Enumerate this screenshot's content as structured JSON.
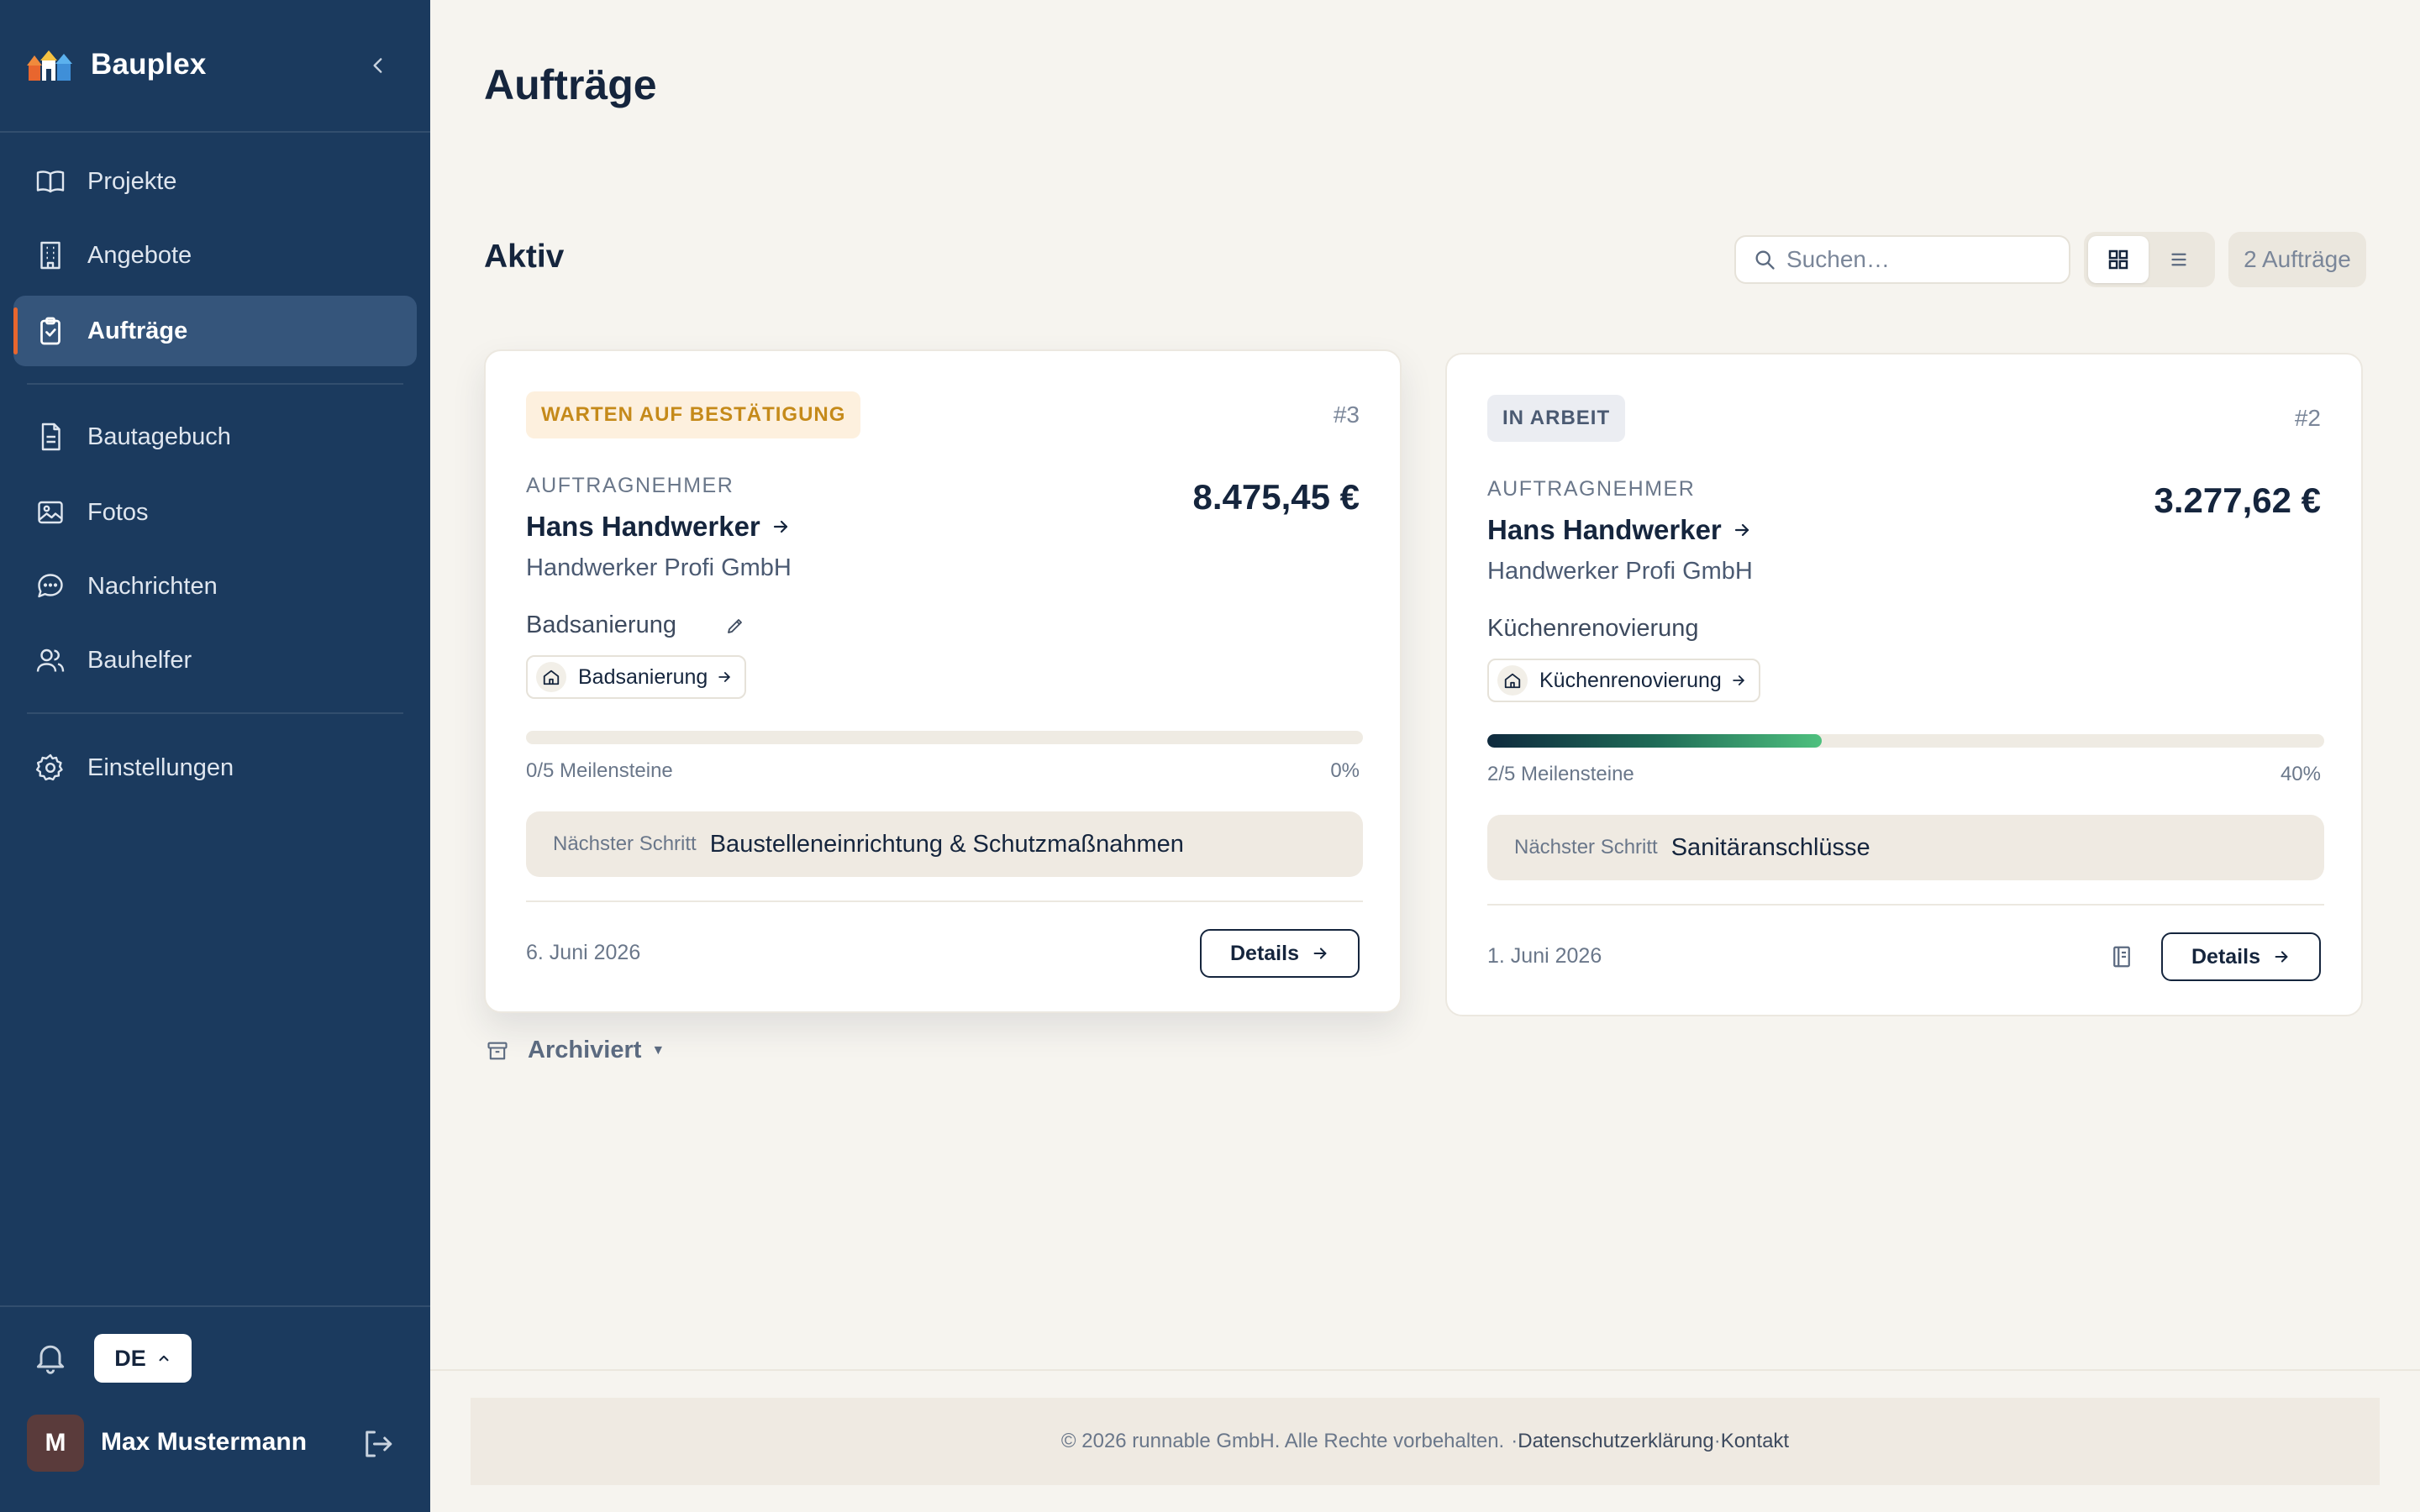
{
  "app": {
    "name": "Bauplex"
  },
  "sidebar": {
    "items": [
      {
        "label": "Projekte",
        "icon": "book-open-icon"
      },
      {
        "label": "Angebote",
        "icon": "building-icon"
      },
      {
        "label": "Aufträge",
        "icon": "clipboard-check-icon",
        "active": true
      },
      {
        "label": "Bautagebuch",
        "icon": "document-icon"
      },
      {
        "label": "Fotos",
        "icon": "image-icon"
      },
      {
        "label": "Nachrichten",
        "icon": "chat-icon"
      },
      {
        "label": "Bauhelfer",
        "icon": "users-icon"
      },
      {
        "label": "Einstellungen",
        "icon": "gear-icon"
      }
    ],
    "language": "DE",
    "user": {
      "initial": "M",
      "name": "Max Mustermann"
    }
  },
  "page": {
    "title": "Aufträge"
  },
  "section": {
    "title": "Aktiv",
    "search_placeholder": "Suchen…",
    "count": "2 Aufträge",
    "view_mode": "grid"
  },
  "orders": [
    {
      "status": "WARTEN AUF BESTÄTIGUNG",
      "status_color": "#c58a1a",
      "number": "#3",
      "contractor_label": "AUFTRAGNEHMER",
      "contractor": "Hans Handwerker",
      "amount": "8.475,45 €",
      "company": "Handwerker Profi GmbH",
      "project_title": "Badsanierung",
      "project_tag": "Badsanierung",
      "progress": 0,
      "milestones": "0/5 Meilensteine",
      "percent": "0%",
      "next_step_label": "Nächster Schritt",
      "next_step": "Baustelleneinrichtung & Schutzmaßnahmen",
      "date": "6. Juni 2026",
      "details_label": "Details"
    },
    {
      "status": "IN ARBEIT",
      "status_color": "#4b5a72",
      "number": "#2",
      "contractor_label": "AUFTRAGNEHMER",
      "contractor": "Hans Handwerker",
      "amount": "3.277,62 €",
      "company": "Handwerker Profi GmbH",
      "project_title": "Küchenrenovierung",
      "project_tag": "Küchenrenovierung",
      "progress": 0.4,
      "milestones": "2/5 Meilensteine",
      "percent": "40%",
      "next_step_label": "Nächster Schritt",
      "next_step": "Sanitäranschlüsse",
      "date": "1. Juni 2026",
      "details_label": "Details"
    }
  ],
  "archived": {
    "label": "Archiviert"
  },
  "footer": {
    "copyright": "© 2026 runnable GmbH. Alle Rechte vorbehalten.",
    "separator": "·",
    "privacy": "Datenschutzerklärung",
    "contact": "Kontakt"
  },
  "colors": {
    "sidebar_bg": "#1b3a5e",
    "accent": "#e8662e",
    "page_bg": "#f6f4ef",
    "text": "#15253d",
    "progress_start": "#0f2a3e",
    "progress_end": "#4ec07e"
  }
}
